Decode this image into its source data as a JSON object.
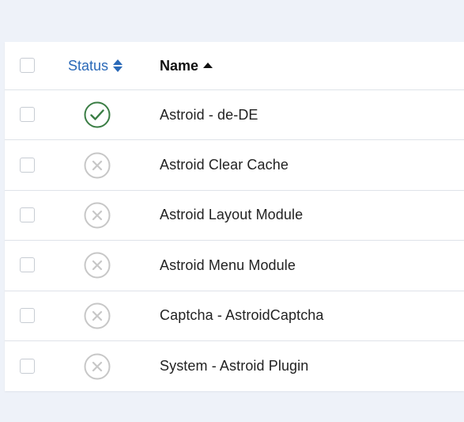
{
  "table": {
    "header": {
      "status_label": "Status",
      "name_label": "Name",
      "sort_icon": "sort-both-icon",
      "sort_active_icon": "sort-ascending-icon"
    },
    "rows": [
      {
        "name": "Astroid - de-DE",
        "enabled": true
      },
      {
        "name": "Astroid Clear Cache",
        "enabled": false
      },
      {
        "name": "Astroid Layout Module",
        "enabled": false
      },
      {
        "name": "Astroid Menu Module",
        "enabled": false
      },
      {
        "name": "Captcha - AstroidCaptcha",
        "enabled": false
      },
      {
        "name": "System - Astroid Plugin",
        "enabled": false
      }
    ]
  },
  "colors": {
    "background": "#eef2f9",
    "link_blue": "#2a69b8",
    "enabled_green": "#3a7d44",
    "disabled_gray": "#c7c7c7",
    "border": "#dfe3e9"
  },
  "icons": {
    "enabled": "check-circle-icon",
    "disabled": "times-circle-icon"
  }
}
